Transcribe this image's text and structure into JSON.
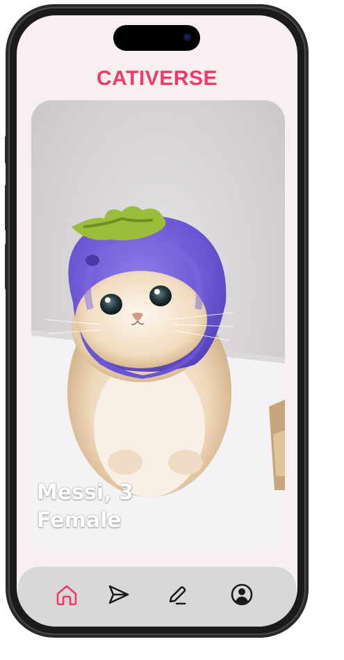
{
  "app": {
    "title": "CATIVERSE",
    "accent_color": "#f0396b"
  },
  "profile_card": {
    "name_age": "Messi, 3",
    "gender": "Female",
    "photo_icon": "cat-in-blueberry-hat-photo"
  },
  "nav": {
    "items": [
      {
        "id": "home",
        "icon": "home-icon",
        "active": true
      },
      {
        "id": "send",
        "icon": "send-icon",
        "active": false
      },
      {
        "id": "edit",
        "icon": "pencil-icon",
        "active": false
      },
      {
        "id": "profile",
        "icon": "user-circle-icon",
        "active": false
      }
    ],
    "active_color": "#f0396b",
    "inactive_color": "#1a1a1a"
  }
}
